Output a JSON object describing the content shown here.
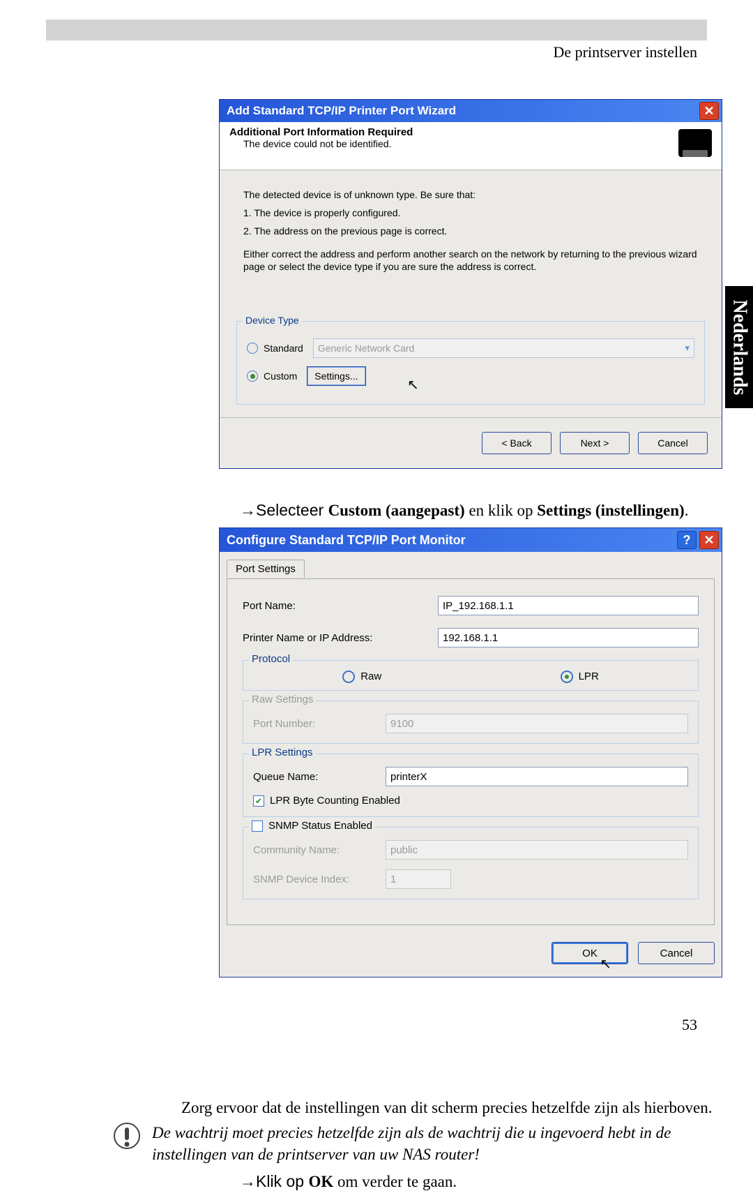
{
  "header": {
    "section_title": "De printserver instellen"
  },
  "side_tab": {
    "label": "Nederlands"
  },
  "page_number": "53",
  "wizard": {
    "title": "Add Standard TCP/IP Printer Port Wizard",
    "heading": "Additional Port Information Required",
    "subheading": "The device could not be identified.",
    "body_line1": "The detected device is of unknown type.  Be sure that:",
    "body_line2": "1.  The device is properly configured.",
    "body_line3": "2.  The address on the previous page is correct.",
    "body_line4": "Either correct the address and perform another search on the network by returning to the previous wizard page or select the device type if you are sure the address is correct.",
    "fieldset_legend": "Device Type",
    "radio_standard": "Standard",
    "combo_value": "Generic Network Card",
    "radio_custom": "Custom",
    "settings_button": "Settings...",
    "btn_back": "< Back",
    "btn_next": "Next >",
    "btn_cancel": "Cancel"
  },
  "instruction1": {
    "prefix": "→Selecteer ",
    "bold1": "Custom (aangepast)",
    "mid": " en klik op ",
    "bold2": "Settings (instellingen)",
    "suffix": "."
  },
  "portmon": {
    "title": "Configure Standard TCP/IP Port Monitor",
    "tab_label": "Port Settings",
    "port_name_label": "Port Name:",
    "port_name_value": "IP_192.168.1.1",
    "printer_addr_label": "Printer Name or IP Address:",
    "printer_addr_value": "192.168.1.1",
    "protocol_legend": "Protocol",
    "proto_raw": "Raw",
    "proto_lpr": "LPR",
    "raw_legend": "Raw Settings",
    "raw_port_label": "Port Number:",
    "raw_port_value": "9100",
    "lpr_legend": "LPR Settings",
    "lpr_queue_label": "Queue Name:",
    "lpr_queue_value": "printerX",
    "lpr_byte_label": "LPR Byte Counting Enabled",
    "snmp_legend": "SNMP Status Enabled",
    "snmp_comm_label": "Community Name:",
    "snmp_comm_value": "public",
    "snmp_index_label": "SNMP Device Index:",
    "snmp_index_value": "1",
    "btn_ok": "OK",
    "btn_cancel": "Cancel"
  },
  "instruction2": "Zorg ervoor dat de instellingen van dit scherm precies hetzelfde zijn als hierboven.",
  "note_italic": "De wachtrij moet precies hetzelfde zijn als de wachtrij die u ingevoerd hebt in de instellingen van de printserver van uw NAS router!",
  "instruction3": {
    "prefix": "→Klik op ",
    "bold": "OK",
    "suffix": " om verder te gaan."
  }
}
